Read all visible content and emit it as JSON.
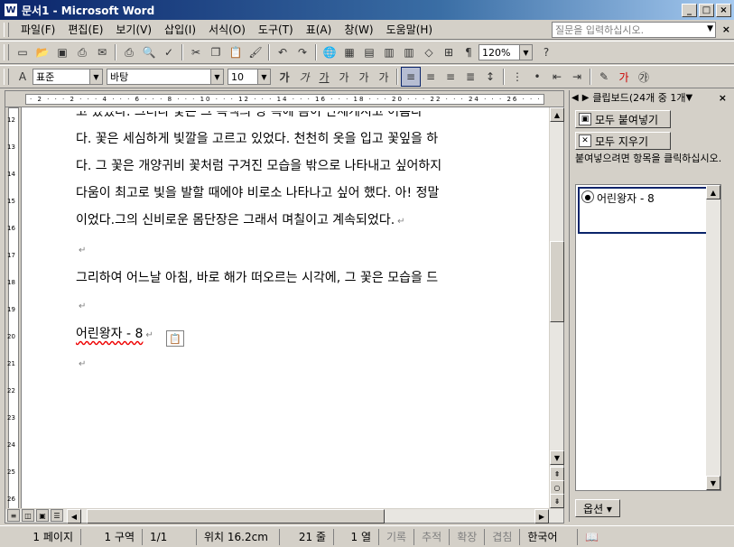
{
  "window": {
    "icon": "W",
    "title": "문서1 - Microsoft Word",
    "minimize": "_",
    "maximize": "□",
    "close": "×"
  },
  "menu": {
    "items": [
      "파일(F)",
      "편집(E)",
      "보기(V)",
      "삽입(I)",
      "서식(O)",
      "도구(T)",
      "표(A)",
      "창(W)",
      "도움말(H)"
    ],
    "ask_placeholder": "질문을 입력하십시오.",
    "close": "×"
  },
  "standard_toolbar": {
    "zoom": "120%"
  },
  "format_toolbar": {
    "style": "표준",
    "font": "바탕",
    "size": "10"
  },
  "ruler": {
    "marks": "· 2 · · · 2 · · · 4 · · · 6 · · · 8 · · · 10 · · · 12 · · · 14 · · · 16 · · · 18 · · · 20 · · · 22 · · · 24 · · · 26 · · · 28 · · · 30 · · · 32",
    "vertical": [
      "12",
      "13",
      "14",
      "15",
      "16",
      "17",
      "18",
      "19",
      "20",
      "21",
      "22",
      "23",
      "24",
      "25",
      "26"
    ]
  },
  "document": {
    "lines": [
      "고 있었다. 그러나 꽃은 그 녹색의 방 속에 몸이 단세게시고 어름다",
      "다. 꽃은 세심하게 빛깔을 고르고 있었다. 천천히 옷을 입고 꽃잎을 하",
      "다. 그 꽃은 개양귀비 꽃처럼 구겨진 모습을 밖으로 나타내고 싶어하지",
      "다움이 최고로 빛을 발할 때에야 비로소 나타나고 싶어 했다. 아! 정말",
      "이었다.그의 신비로운 몸단장은 그래서 며칠이고 계속되었다."
    ],
    "para2": "그리하여 어느날 아침, 바로 해가 떠오르는 시각에, 그 꽃은 모습을 드",
    "para3": "어린왕자 - 8",
    "para_mark": "↵"
  },
  "taskpane": {
    "title": "클립보드(24개 중 1개",
    "paste_all": "모두 붙여넣기",
    "clear_all": "모두 지우기",
    "hint": "붙여넣으려면 항목을 클릭하십시오.",
    "clip_item": "어린왕자 - 8",
    "options": "옵션 ▾"
  },
  "status": {
    "page": "1 페이지",
    "section": "1 구역",
    "pages": "1/1",
    "position": "위치 16.2cm",
    "line": "21 줄",
    "column": "1 열",
    "rec": "기록",
    "trk": "추적",
    "ext": "확장",
    "ovr": "겹침",
    "lang": "한국어"
  }
}
